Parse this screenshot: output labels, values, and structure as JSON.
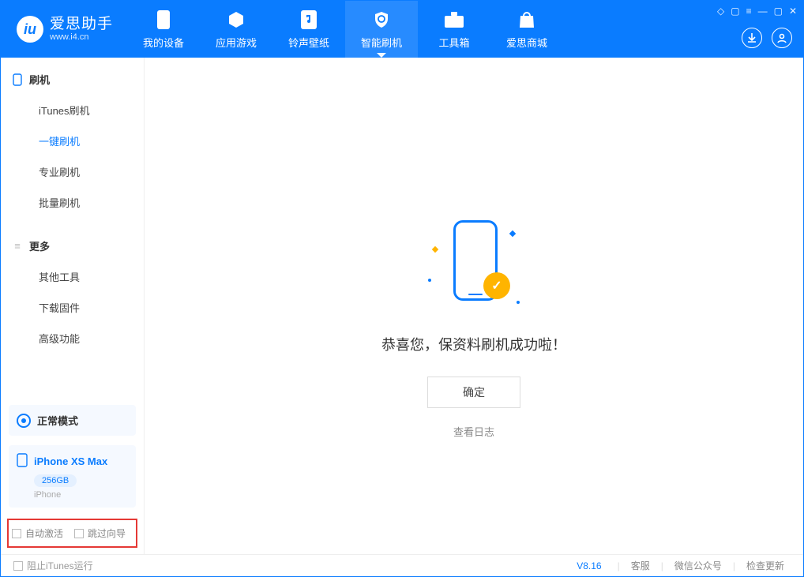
{
  "logo": {
    "glyph": "iu",
    "title": "爱思助手",
    "subtitle": "www.i4.cn"
  },
  "nav": {
    "items": [
      {
        "label": "我的设备"
      },
      {
        "label": "应用游戏"
      },
      {
        "label": "铃声壁纸"
      },
      {
        "label": "智能刷机"
      },
      {
        "label": "工具箱"
      },
      {
        "label": "爱思商城"
      }
    ]
  },
  "sidebar": {
    "group_flash": "刷机",
    "items_flash": [
      "iTunes刷机",
      "一键刷机",
      "专业刷机",
      "批量刷机"
    ],
    "group_more": "更多",
    "items_more": [
      "其他工具",
      "下载固件",
      "高级功能"
    ],
    "mode_label": "正常模式",
    "device_name": "iPhone XS Max",
    "device_storage": "256GB",
    "device_type": "iPhone",
    "auto_activate": "自动激活",
    "skip_guide": "跳过向导"
  },
  "main": {
    "success_msg": "恭喜您，保资料刷机成功啦！",
    "ok_btn": "确定",
    "view_log": "查看日志",
    "checkmark": "✓"
  },
  "footer": {
    "block_itunes": "阻止iTunes运行",
    "version": "V8.16",
    "support": "客服",
    "wechat": "微信公众号",
    "check_update": "检查更新"
  }
}
